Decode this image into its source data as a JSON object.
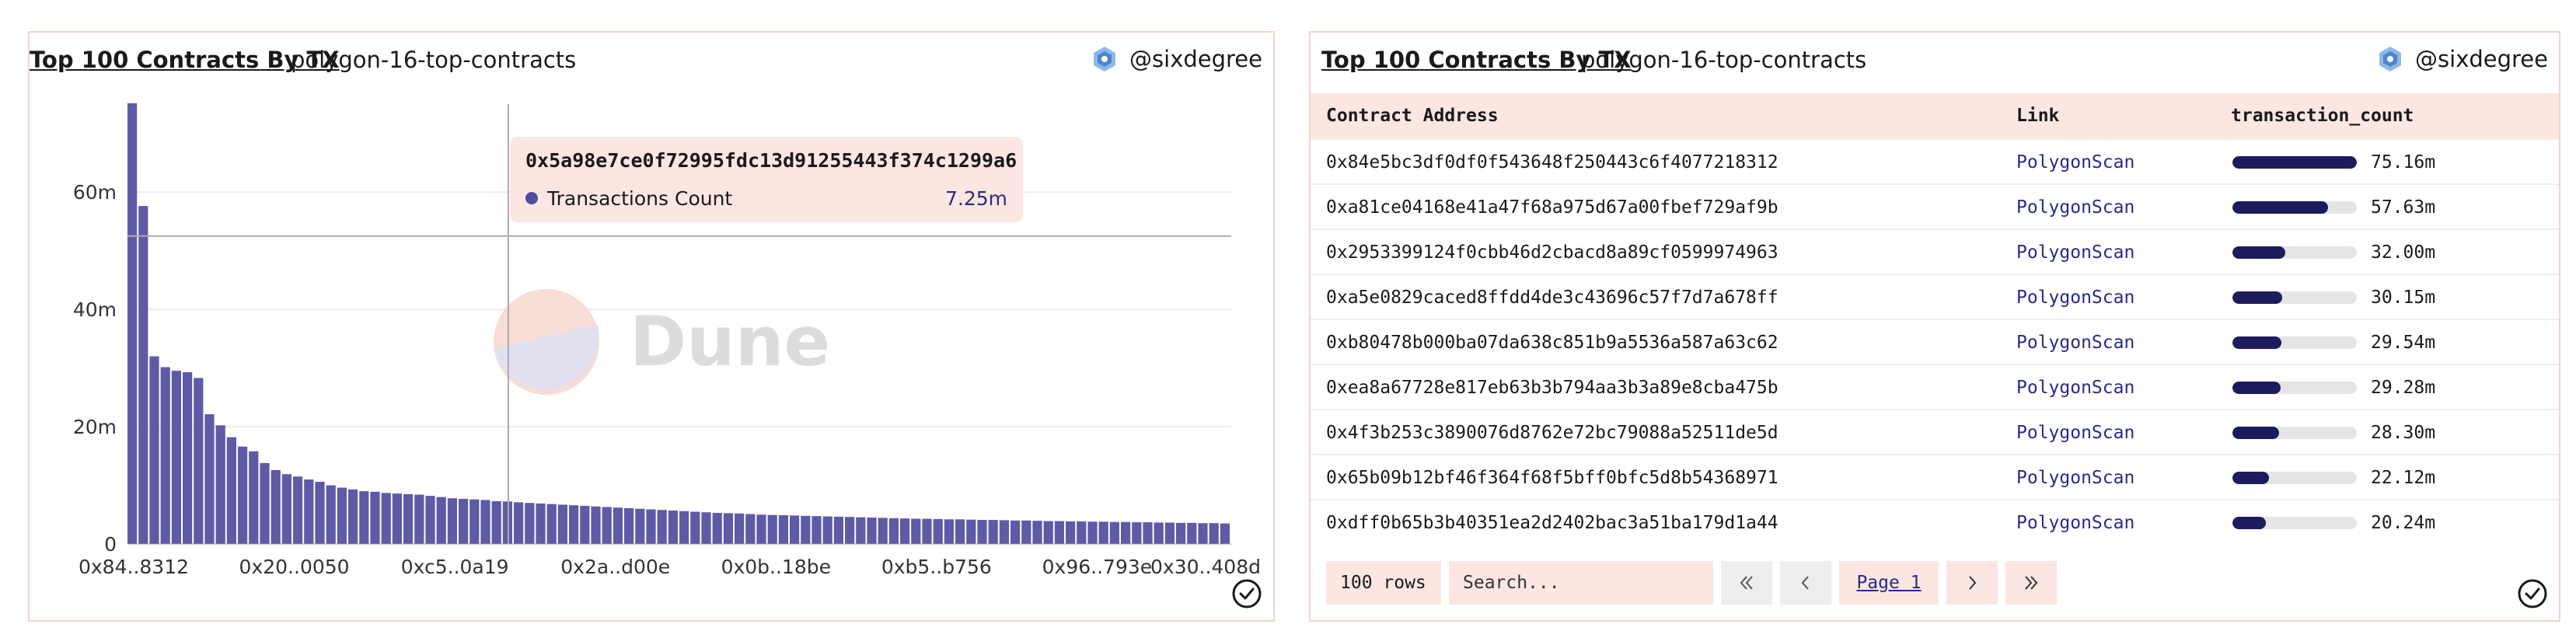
{
  "left_panel": {
    "title": "Top 100 Contracts By TX",
    "slug": "polygon-16-top-contracts",
    "author": "@sixdegree",
    "watermark": "Dune",
    "tooltip": {
      "address": "0x5a98e7ce0f72995fdc13d91255443f374c1299a6",
      "series": "Transactions Count",
      "value": "7.25m"
    }
  },
  "chart_data": {
    "type": "bar",
    "series": [
      {
        "name": "Transactions Count",
        "color": "#5e5aa6"
      }
    ],
    "ylim": [
      0,
      75
    ],
    "y_ticks": [
      0,
      20,
      40,
      60
    ],
    "y_tick_labels": [
      "0",
      "20m",
      "40m",
      "60m"
    ],
    "x_tick_labels": [
      "0x84..8312",
      "0x20..0050",
      "0xc5..0a19",
      "0x2a..d00e",
      "0x0b..18be",
      "0xb5..b756",
      "0x96..793e",
      "0x30..408d"
    ],
    "values": [
      75.16,
      57.63,
      32.0,
      30.15,
      29.54,
      29.28,
      28.3,
      22.12,
      20.24,
      18.2,
      16.6,
      15.8,
      13.8,
      12.6,
      11.9,
      11.5,
      11.0,
      10.6,
      10.0,
      9.6,
      9.3,
      9.0,
      8.9,
      8.7,
      8.6,
      8.5,
      8.4,
      8.2,
      8.0,
      7.8,
      7.7,
      7.6,
      7.5,
      7.3,
      7.25,
      7.1,
      7.0,
      6.9,
      6.8,
      6.7,
      6.6,
      6.5,
      6.4,
      6.3,
      6.2,
      6.1,
      6.0,
      5.9,
      5.8,
      5.7,
      5.6,
      5.5,
      5.4,
      5.3,
      5.25,
      5.2,
      5.1,
      5.0,
      4.95,
      4.9,
      4.85,
      4.8,
      4.75,
      4.7,
      4.65,
      4.6,
      4.55,
      4.5,
      4.45,
      4.4,
      4.35,
      4.3,
      4.3,
      4.25,
      4.2,
      4.2,
      4.15,
      4.1,
      4.1,
      4.05,
      4.0,
      4.0,
      3.95,
      3.9,
      3.9,
      3.85,
      3.85,
      3.8,
      3.8,
      3.75,
      3.75,
      3.7,
      3.7,
      3.65,
      3.65,
      3.6,
      3.6,
      3.55,
      3.55,
      3.5
    ],
    "hover_index": 34,
    "crosshair_value": 52.5
  },
  "right_panel": {
    "title": "Top 100 Contracts By TX",
    "slug": "polygon-16-top-contracts",
    "author": "@sixdegree",
    "columns": [
      "Contract Address",
      "Link",
      "transaction_count"
    ],
    "rows": [
      {
        "address": "0x84e5bc3df0df0f543648f250443c6f4077218312",
        "link": "PolygonScan",
        "count": "75.16m",
        "fraction": 1.0
      },
      {
        "address": "0xa81ce04168e41a47f68a975d67a00fbef729af9b",
        "link": "PolygonScan",
        "count": "57.63m",
        "fraction": 0.767
      },
      {
        "address": "0x2953399124f0cbb46d2cbacd8a89cf0599974963",
        "link": "PolygonScan",
        "count": "32.00m",
        "fraction": 0.426
      },
      {
        "address": "0xa5e0829caced8ffdd4de3c43696c57f7d7a678ff",
        "link": "PolygonScan",
        "count": "30.15m",
        "fraction": 0.401
      },
      {
        "address": "0xb80478b000ba07da638c851b9a5536a587a63c62",
        "link": "PolygonScan",
        "count": "29.54m",
        "fraction": 0.393
      },
      {
        "address": "0xea8a67728e817eb63b3b794aa3b3a89e8cba475b",
        "link": "PolygonScan",
        "count": "29.28m",
        "fraction": 0.39
      },
      {
        "address": "0x4f3b253c3890076d8762e72bc79088a52511de5d",
        "link": "PolygonScan",
        "count": "28.30m",
        "fraction": 0.377
      },
      {
        "address": "0x65b09b12bf46f364f68f5bff0bfc5d8b54368971",
        "link": "PolygonScan",
        "count": "22.12m",
        "fraction": 0.294
      },
      {
        "address": "0xdff0b65b3b40351ea2d2402bac3a51ba179d1a44",
        "link": "PolygonScan",
        "count": "20.24m",
        "fraction": 0.269
      }
    ],
    "footer": {
      "rows_label": "100 rows",
      "search_placeholder": "Search...",
      "first_icon": "double-chevron-left",
      "prev_icon": "chevron-left",
      "page_label": "Page 1",
      "next_icon": "chevron-right",
      "last_icon": "double-chevron-right"
    }
  },
  "colors": {
    "bar": "#5e5aa6",
    "accent_bg": "#fbe6e2",
    "border": "#f0d4cc",
    "progress": "#1c1c5c",
    "link": "#2a2a8a"
  }
}
